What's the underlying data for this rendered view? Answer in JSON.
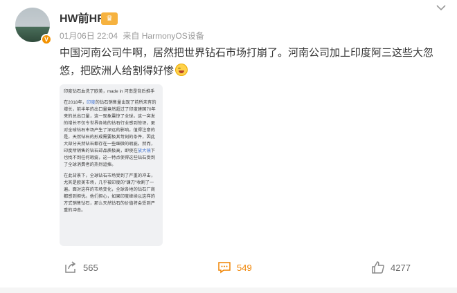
{
  "post": {
    "username": "HW前HR",
    "member_badge": "♛",
    "meta": {
      "date": "01月06日 22:04",
      "source": "来自 HarmonyOS设备"
    },
    "text": "中国河南公司牛啊，居然把世界钻石市场打崩了。河南公司加上印度阿三这些大忽悠，把欧洲人给割得好惨",
    "emoji_icon": "laugh-cry-emoji"
  },
  "image": {
    "title": "印度钻石血洗了欧美，made in 河南是背后推手",
    "para1_pre": "在2018年，",
    "para1_hl": "印度",
    "para1_post": "的钻石销售量出现了前所未有的增长，前半年的出口量竟然超过了印度建国70年来的总出口量，这一现象震惊了全球。这一突发的增长不仅令世界各地的钻石行业感到惊讶，更对全球钻石市场产生了深远的影响。值得注意的是，天然钻石的形成需要极其苛刻的条件，因此大部分天然钻石都存在一些细微的瑕疵。然而，印度所销售的钻石却品质极高，即使在",
    "para1_hl2": "放大镜",
    "para1_end": "下也找不到任何瑕疵，这一特点使得这些钻石受到了全球消费者的热烈追捧。",
    "para2": "在此背景下，全球钻石市场受到了严重的冲击，尤其是欧美市场，几乎被印度的\"镰刀\"收割了一遍。面对这样的市场变化，全球各地的钻石厂商都感到担忧。他们担心，如果印度继续以这样的方式销售钻石，那么天然钻石的价值将会受到严重的冲击。"
  },
  "actions": {
    "repost_count": "565",
    "comment_count": "549",
    "like_count": "4277"
  },
  "colors": {
    "accent": "#f08300",
    "link": "#3b6fd1",
    "muted": "#999999"
  }
}
